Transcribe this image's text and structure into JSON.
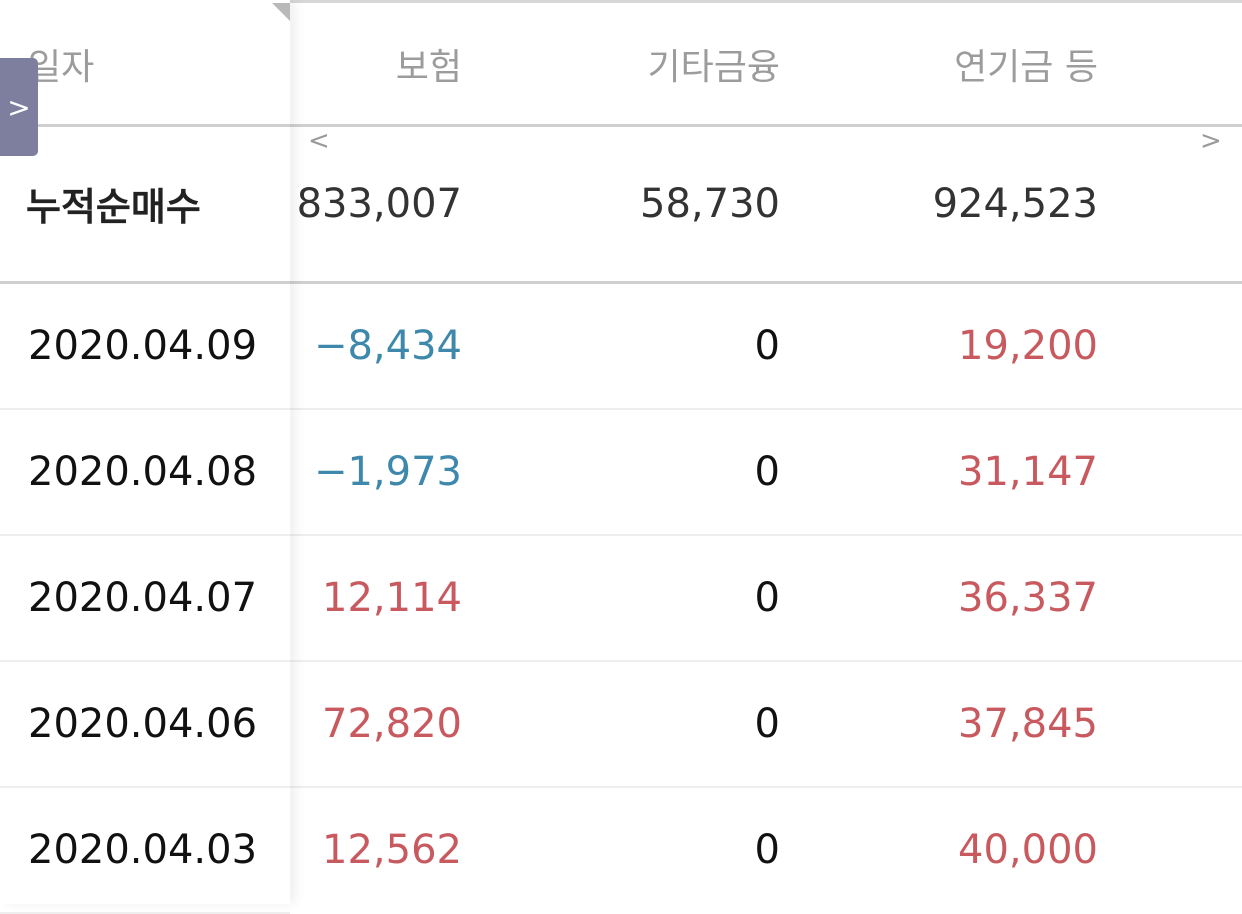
{
  "header": {
    "date": "일자",
    "columns": [
      "보험",
      "기타금융",
      "연기금 등"
    ]
  },
  "summary": {
    "label": "누적순매수",
    "values": [
      "833,007",
      "58,730",
      "924,523"
    ]
  },
  "nav": {
    "left_arrow": "<",
    "right_arrow": ">",
    "tab_arrow": ">"
  },
  "rows": [
    {
      "date": "2020.04.09",
      "values": [
        "−8,434",
        "0",
        "19,200"
      ]
    },
    {
      "date": "2020.04.08",
      "values": [
        "−1,973",
        "0",
        "31,147"
      ]
    },
    {
      "date": "2020.04.07",
      "values": [
        "12,114",
        "0",
        "36,337"
      ]
    },
    {
      "date": "2020.04.06",
      "values": [
        "72,820",
        "0",
        "37,845"
      ]
    },
    {
      "date": "2020.04.03",
      "values": [
        "12,562",
        "0",
        "40,000"
      ]
    }
  ],
  "colors": {
    "negative": "#3d88ab",
    "positive": "#c85a5f",
    "header_text": "#9c9c9c",
    "side_tab": "#7e7f9f"
  }
}
